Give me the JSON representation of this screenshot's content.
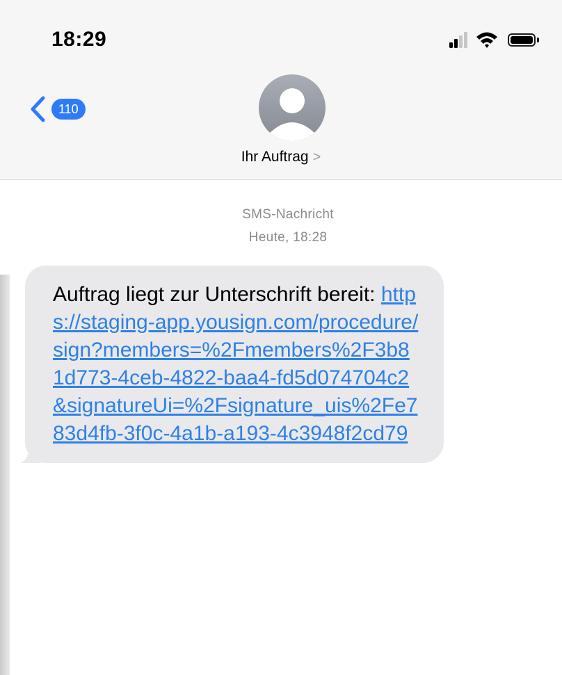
{
  "status_bar": {
    "time": "18:29",
    "icons": [
      "cellular-signal-icon",
      "wifi-icon",
      "battery-icon"
    ]
  },
  "nav": {
    "back_count": "110",
    "contact_name": "Ihr Auftrag",
    "contact_chevron": ">"
  },
  "thread": {
    "service_label": "SMS-Nachricht",
    "timestamp": "Heute, 18:28",
    "messages": [
      {
        "text_prefix": "Auftrag liegt zur Unterschrift bereit: ",
        "link": "https://staging-app.yousign.com/procedure/sign?members=%2Fmembers%2F3b81d773-4ceb-4822-baa4-fd5d074704c2&signatureUi=%2Fsignature_uis%2Fe783d4fb-3f0c-4a1b-a193-4c3948f2cd79"
      }
    ]
  },
  "colors": {
    "accent": "#2f7bf6",
    "link": "#2f80e6",
    "bubble": "#e9e9eb",
    "header_bg": "#f6f6f6",
    "meta_text": "#8a8a8e"
  }
}
